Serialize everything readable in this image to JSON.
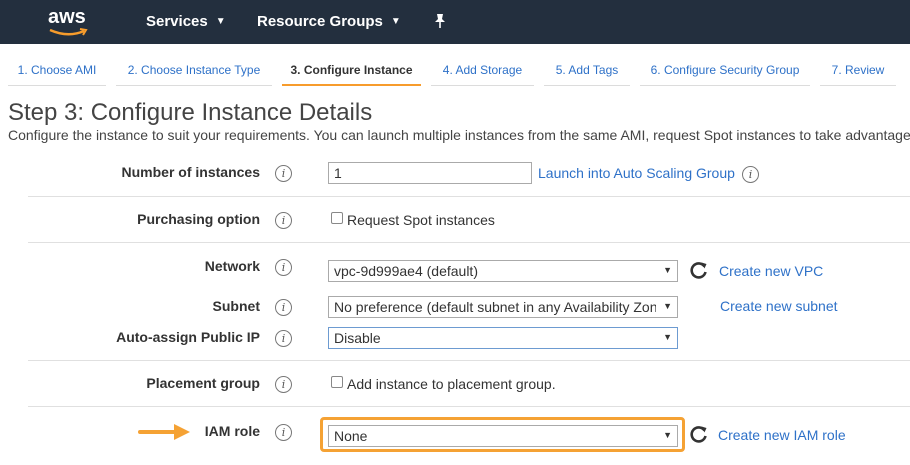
{
  "nav": {
    "logo": "aws",
    "services": "Services",
    "resource_groups": "Resource Groups"
  },
  "tabs": [
    {
      "label": "1. Choose AMI"
    },
    {
      "label": "2. Choose Instance Type"
    },
    {
      "label": "3. Configure Instance"
    },
    {
      "label": "4. Add Storage"
    },
    {
      "label": "5. Add Tags"
    },
    {
      "label": "6. Configure Security Group"
    },
    {
      "label": "7. Review"
    }
  ],
  "page": {
    "title": "Step 3: Configure Instance Details",
    "subtitle": "Configure the instance to suit your requirements. You can launch multiple instances from the same AMI, request Spot instances to take advantage"
  },
  "info_glyph": "i",
  "fields": {
    "instances": {
      "label": "Number of instances",
      "value": "1",
      "link": "Launch into Auto Scaling Group"
    },
    "purchasing": {
      "label": "Purchasing option",
      "checkbox": "Request Spot instances"
    },
    "network": {
      "label": "Network",
      "value": "vpc-9d999ae4 (default)",
      "link": "Create new VPC"
    },
    "subnet": {
      "label": "Subnet",
      "value": "No preference (default subnet in any Availability Zone)",
      "link": "Create new subnet"
    },
    "public_ip": {
      "label": "Auto-assign Public IP",
      "value": "Disable"
    },
    "placement": {
      "label": "Placement group",
      "checkbox": "Add instance to placement group."
    },
    "iam": {
      "label": "IAM role",
      "value": "None",
      "link": "Create new IAM role"
    }
  },
  "colors": {
    "nav_bg": "#232f3e",
    "link": "#2e71c8",
    "accent_orange": "#f5a234"
  }
}
